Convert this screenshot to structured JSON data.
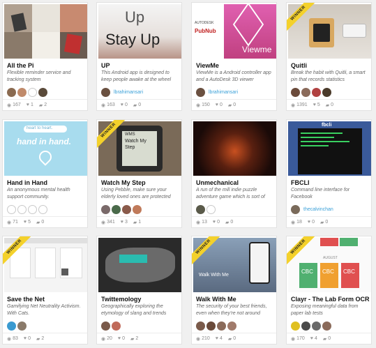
{
  "ribbon_label": "WINNER",
  "stat_icons": {
    "views": "eye-icon",
    "likes": "heart-icon",
    "comments": "comment-icon"
  },
  "cards": [
    {
      "title": "All the Pi",
      "description": "Flexible reminder service and tracking system",
      "owner": "",
      "winner": false,
      "avatars": [
        "#8a6a50",
        "#c08a6a",
        "empty",
        "#5a4a3a"
      ],
      "stats": {
        "views": "167",
        "likes": "1",
        "comments": "2"
      }
    },
    {
      "title": "UP",
      "description": "This Android app is designed to keep people awake at the wheel",
      "owner": "lbrahimansari",
      "winner": false,
      "avatars": [
        "#6a5040"
      ],
      "thumb_text": [
        "Up",
        "Stay Up"
      ],
      "stats": {
        "views": "163",
        "likes": "0",
        "comments": "0"
      }
    },
    {
      "title": "ViewMe",
      "description": "ViewMe is a Android controller app and a AutoDesk 3D viewer",
      "owner": "lbrahimansari",
      "winner": false,
      "avatars": [
        "#6a5040"
      ],
      "thumb_text": [
        "AUTODESK",
        "PubNub",
        "Viewme"
      ],
      "stats": {
        "views": "150",
        "likes": "0",
        "comments": "0"
      }
    },
    {
      "title": "Quitli",
      "description": "Break the habit with Quitli, a smart pin that records statistics",
      "owner": "",
      "winner": true,
      "avatars": [
        "#6a4a3a",
        "#8a6a5a",
        "#b04040",
        "#4a3a2a"
      ],
      "stats": {
        "views": "1391",
        "likes": "5",
        "comments": "0"
      }
    },
    {
      "title": "Hand in Hand",
      "description": "An anonymous mental health support community.",
      "owner": "",
      "winner": false,
      "avatars": [
        "empty",
        "empty",
        "empty",
        "empty"
      ],
      "thumb_text": [
        "heart to heart.",
        "hand in hand."
      ],
      "stats": {
        "views": "71",
        "likes": "5",
        "comments": "0"
      }
    },
    {
      "title": "Watch My Step",
      "description": "Using Pebble, make sure your elderly loved ones are protected",
      "owner": "",
      "winner": true,
      "avatars": [
        "#7a6a6a",
        "#4a6a4a",
        "#8a5a4a",
        "#c07a5a"
      ],
      "thumb_text": [
        "WMS",
        "Watch My",
        "Step"
      ],
      "stats": {
        "views": "341",
        "likes": "3",
        "comments": "1"
      }
    },
    {
      "title": "Unmechanical",
      "description": "A run of the mill indie puzzle adventure game which is sort of",
      "owner": "",
      "winner": false,
      "avatars": [
        "#5a5a4a",
        "empty"
      ],
      "stats": {
        "views": "13",
        "likes": "0",
        "comments": "0"
      }
    },
    {
      "title": "FBCLI",
      "description": "Command line interface for Facebook",
      "owner": "thecalvinchan",
      "winner": false,
      "avatars": [
        "#7a6a5a"
      ],
      "thumb_text": [
        "fbcli"
      ],
      "stats": {
        "views": "18",
        "likes": "0",
        "comments": "0"
      }
    },
    {
      "title": "Save the Net",
      "description": "Gamifying Net Neutrality Activism. With Cats.",
      "owner": "",
      "winner": true,
      "avatars": [
        "#3a9ad0",
        "#8a7a6a"
      ],
      "stats": {
        "views": "83",
        "likes": "0",
        "comments": "2"
      }
    },
    {
      "title": "Twittemology",
      "description": "Geographically exploring the etymology of slang and trends",
      "owner": "",
      "winner": false,
      "avatars": [
        "#7a5a4a",
        "#c06a5a"
      ],
      "stats": {
        "views": "20",
        "likes": "0",
        "comments": "2"
      }
    },
    {
      "title": "Walk With Me",
      "description": "The security of your best friends, even when they're not around",
      "owner": "",
      "winner": true,
      "avatars": [
        "#7a5a4a",
        "#6a4a3a",
        "#8a6a5a",
        "#a07a6a"
      ],
      "thumb_text": [
        "Walk With Me"
      ],
      "stats": {
        "views": "210",
        "likes": "4",
        "comments": "0"
      }
    },
    {
      "title": "Clayr - The Lab Form OCR",
      "description": "Exposing meaningful data from paper lab tests",
      "owner": "",
      "winner": true,
      "avatars": [
        "#e0c020",
        "#4a4a4a",
        "#6a6a6a",
        "#8a6a5a"
      ],
      "thumb_text": [
        "CBC",
        "AUGUST",
        "CBC",
        "CBC"
      ],
      "stats": {
        "views": "170",
        "likes": "4",
        "comments": "0"
      }
    }
  ]
}
